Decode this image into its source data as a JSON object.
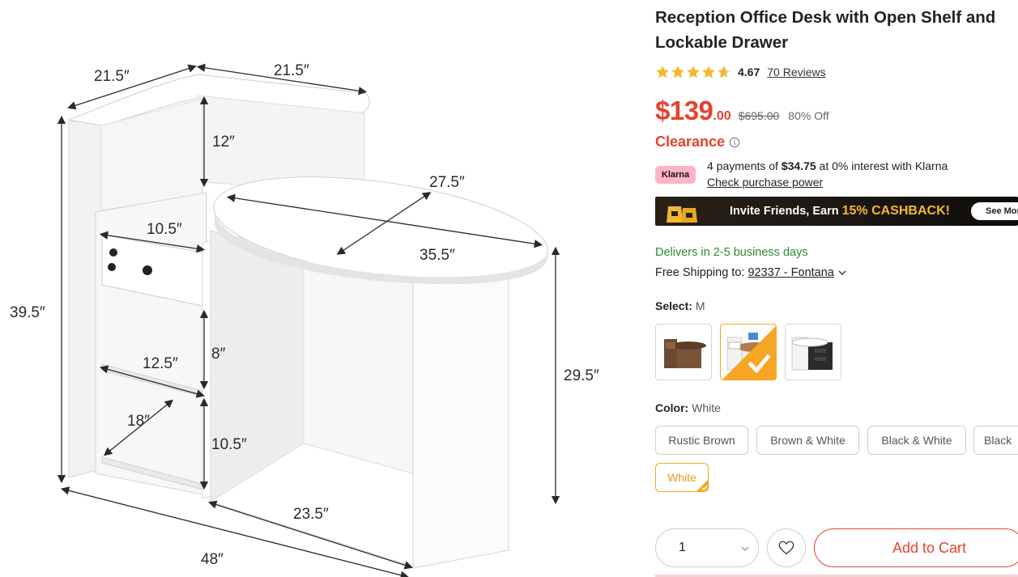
{
  "image": {
    "dimensions": {
      "top_left": "21.5″",
      "top_right": "21.5″",
      "upper_gap": "12″",
      "top_width": "27.5″",
      "drawer_width": "10.5″",
      "top_length": "35.5″",
      "total_height": "39.5″",
      "shelf_height_1": "8″",
      "shelf_depth_1": "12.5″",
      "desk_height": "29.5″",
      "shelf_depth_2": "18″",
      "shelf_height_2": "10.5″",
      "knee_width": "23.5″",
      "total_width": "48″"
    }
  },
  "product": {
    "title": "Reception Office Desk with Open Shelf and Lockable Drawer",
    "rating": 4.67,
    "rating_text": "4.67",
    "reviews_text": "70 Reviews",
    "price_main": "$139",
    "price_cents": ".00",
    "price_original": "$695.00",
    "discount": "80% Off",
    "clearance": "Clearance",
    "klarna": {
      "badge": "Klarna",
      "prefix": "4 payments of ",
      "amount": "$34.75",
      "suffix": " at 0% interest with Klarna",
      "link": "Check purchase power"
    },
    "cashback": {
      "prefix": "Invite Friends, Earn ",
      "highlight": "15% CASHBACK!",
      "button": "See More"
    },
    "delivery": "Delivers in 2-5 business days",
    "shipping_prefix": "Free Shipping to:",
    "shipping_zip": "92337 - Fontana",
    "select_label": "Select:",
    "select_value": "M",
    "color_label": "Color:",
    "color_value": "White",
    "colors": [
      "Rustic Brown",
      "Brown & White",
      "Black & White",
      "Black",
      "White"
    ],
    "quantity": "1",
    "add_to_cart": "Add to Cart"
  },
  "colors": {
    "accent_red": "#e5432f",
    "accent_orange": "#f5a623",
    "green": "#2e8a2e",
    "klarna_pink": "#ffb3c7",
    "star": "#f5b82e"
  },
  "icons": [
    "star-icon",
    "info-icon",
    "chevron-down-icon",
    "heart-icon",
    "checkmark-icon",
    "gift-bag-icon"
  ]
}
